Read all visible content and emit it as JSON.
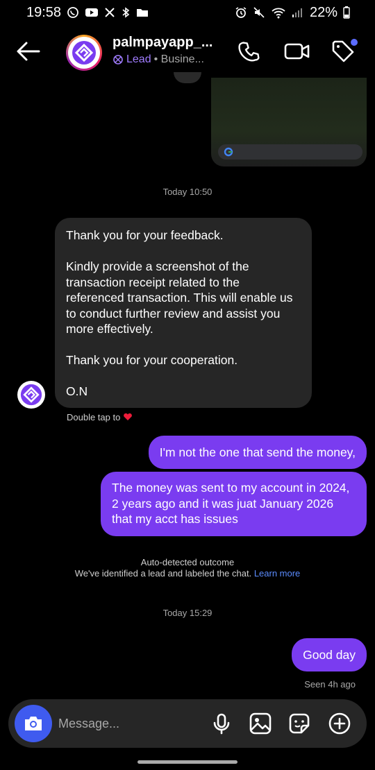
{
  "status_bar": {
    "time": "19:58",
    "battery": "22%",
    "left_icons": [
      "whatsapp-icon",
      "youtube-icon",
      "x-icon",
      "bluetooth-icon",
      "folder-icon"
    ],
    "right_icons": [
      "alarm-icon",
      "mute-icon",
      "wifi-icon",
      "signal-icon",
      "battery-icon"
    ]
  },
  "header": {
    "username": "palmpayapp_...",
    "label": "Lead",
    "category": "• Busine..."
  },
  "chat": {
    "timestamp_1": "Today 10:50",
    "incoming_message": {
      "paragraphs": [
        "Thank you for your feedback.",
        "Kindly provide a screenshot of the transaction receipt related to the referenced transaction. This will enable us to conduct further review and assist you more effectively.",
        "Thank you for your cooperation.",
        "O.N"
      ]
    },
    "double_tap": "Double tap to",
    "outgoing_1": "I'm not the one that send the money,",
    "outgoing_2": "The money was sent to my account in 2024, 2 years ago and it was juat January 2026 that my acct has issues",
    "auto_detect_title": "Auto-detected outcome",
    "auto_detect_text": "We've identified a lead and labeled the chat.",
    "learn_more": "Learn more",
    "timestamp_2": "Today 15:29",
    "outgoing_3": "Good day",
    "seen": "Seen 4h ago"
  },
  "composer": {
    "placeholder": "Message..."
  },
  "colors": {
    "outgoing_bubble": "#7a3cf0",
    "incoming_bubble": "#262626",
    "camera_button": "#3f5bef",
    "lead_label": "#a07cff",
    "link": "#5b8cff"
  }
}
